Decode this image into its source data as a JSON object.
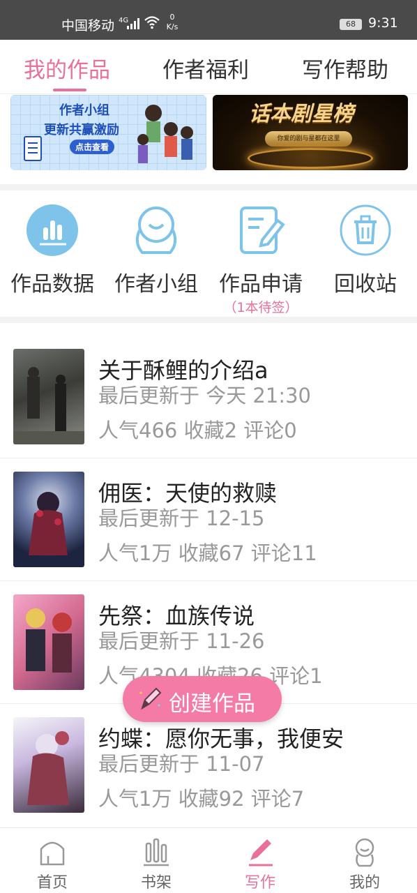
{
  "status_bar": {
    "carrier": "中国移动",
    "network": "4G",
    "speed_value": "0",
    "speed_unit": "K/s",
    "battery": "68",
    "time": "9:31"
  },
  "top_tabs": [
    {
      "label": "我的作品",
      "active": true
    },
    {
      "label": "作者福利",
      "active": false
    },
    {
      "label": "写作帮助",
      "active": false
    }
  ],
  "banners": {
    "left": {
      "line1": "作者小组",
      "line2": "更新共赢激励",
      "button": "点击查看"
    },
    "right": {
      "title": "话本剧星榜",
      "subtitle": "你爱的剧与星都在这里"
    }
  },
  "shortcuts": [
    {
      "label": "作品数据",
      "icon": "bar-chart-icon"
    },
    {
      "label": "作者小组",
      "icon": "group-avatar-icon"
    },
    {
      "label": "作品申请",
      "icon": "edit-document-icon",
      "sub": "（1本待签）"
    },
    {
      "label": "回收站",
      "icon": "trash-icon"
    }
  ],
  "works": [
    {
      "title": "关于酥鲤的介绍a",
      "updated": "最后更新于 今天 21:30",
      "stats": "人气466 收藏2 评论0"
    },
    {
      "title": "佣医：天使的救赎",
      "updated": "最后更新于 12-15",
      "stats": "人气1万 收藏67 评论11"
    },
    {
      "title": "先祭：血族传说",
      "updated": "最后更新于 11-26",
      "stats": "人气4304 收藏26 评论1"
    },
    {
      "title": "约蝶：愿你无事，我便安",
      "updated": "最后更新于 11-07",
      "stats": "人气1万 收藏92 评论7"
    }
  ],
  "fab": {
    "label": "创建作品",
    "icon": "pencil-icon"
  },
  "bottom_nav": [
    {
      "label": "首页",
      "icon": "home-icon",
      "active": false
    },
    {
      "label": "书架",
      "icon": "bookshelf-icon",
      "active": false
    },
    {
      "label": "写作",
      "icon": "pen-icon",
      "active": true
    },
    {
      "label": "我的",
      "icon": "profile-icon",
      "active": false
    }
  ],
  "colors": {
    "accent": "#e8709a",
    "fab": "#f47ba5",
    "icon_blue": "#7ec3ea"
  }
}
